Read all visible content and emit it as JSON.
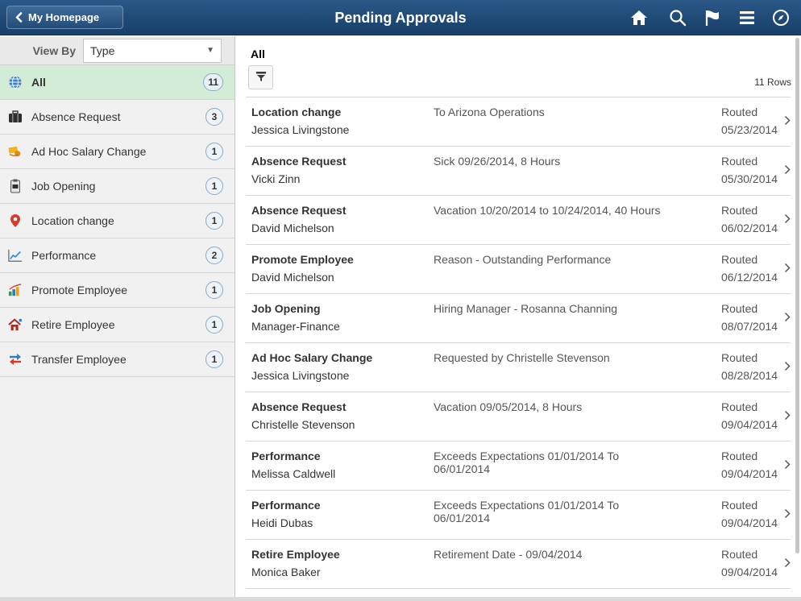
{
  "header": {
    "back_label": "My Homepage",
    "title": "Pending Approvals",
    "icons": [
      "home-icon",
      "search-icon",
      "flag-icon",
      "menu-icon",
      "compass-icon"
    ]
  },
  "sidebar": {
    "view_by_label": "View By",
    "view_by_value": "Type",
    "items": [
      {
        "label": "All",
        "count": "11",
        "icon": "globe-icon",
        "selected": true
      },
      {
        "label": "Absence Request",
        "count": "3",
        "icon": "briefcase-icon"
      },
      {
        "label": "Ad Hoc Salary Change",
        "count": "1",
        "icon": "money-icon"
      },
      {
        "label": "Job Opening",
        "count": "1",
        "icon": "badge-icon"
      },
      {
        "label": "Location change",
        "count": "1",
        "icon": "location-pin-icon"
      },
      {
        "label": "Performance",
        "count": "2",
        "icon": "line-chart-icon"
      },
      {
        "label": "Promote Employee",
        "count": "1",
        "icon": "bar-chart-icon"
      },
      {
        "label": "Retire Employee",
        "count": "1",
        "icon": "house-icon"
      },
      {
        "label": "Transfer Employee",
        "count": "1",
        "icon": "transfer-arrows-icon"
      }
    ]
  },
  "main": {
    "title": "All",
    "rows_count": "11 Rows",
    "rows": [
      {
        "type": "Location change",
        "person": "Jessica Livingstone",
        "desc": "To Arizona Operations",
        "status": "Routed",
        "date": "05/23/2014"
      },
      {
        "type": "Absence Request",
        "person": "Vicki Zinn",
        "desc": "Sick 09/26/2014, 8 Hours",
        "status": "Routed",
        "date": "05/30/2014"
      },
      {
        "type": "Absence Request",
        "person": "David Michelson",
        "desc": "Vacation 10/20/2014 to  10/24/2014, 40 Hours",
        "status": "Routed",
        "date": "06/02/2014"
      },
      {
        "type": "Promote Employee",
        "person": "David Michelson",
        "desc": "Reason - Outstanding Performance",
        "status": "Routed",
        "date": "06/12/2014"
      },
      {
        "type": "Job Opening",
        "person": "Manager-Finance",
        "desc": "Hiring Manager - Rosanna Channing",
        "status": "Routed",
        "date": "08/07/2014"
      },
      {
        "type": "Ad Hoc Salary Change",
        "person": "Jessica Livingstone",
        "desc": "Requested by Christelle Stevenson",
        "status": "Routed",
        "date": "08/28/2014"
      },
      {
        "type": "Absence Request",
        "person": "Christelle Stevenson",
        "desc": "Vacation 09/05/2014, 8 Hours",
        "status": "Routed",
        "date": "09/04/2014"
      },
      {
        "type": "Performance",
        "person": "Melissa Caldwell",
        "desc": "Exceeds Expectations 01/01/2014 To 06/01/2014",
        "status": "Routed",
        "date": "09/04/2014"
      },
      {
        "type": "Performance",
        "person": "Heidi Dubas",
        "desc": "Exceeds Expectations 01/01/2014 To 06/01/2014",
        "status": "Routed",
        "date": "09/04/2014"
      },
      {
        "type": "Retire Employee",
        "person": "Monica Baker",
        "desc": "Retirement Date - 09/04/2014",
        "status": "Routed",
        "date": "09/04/2014"
      }
    ]
  },
  "colors": {
    "header_top": "#2a5887",
    "header_bottom": "#173f68",
    "selected_row": "#d3ecd7",
    "badge_border": "#8aa9c7"
  }
}
